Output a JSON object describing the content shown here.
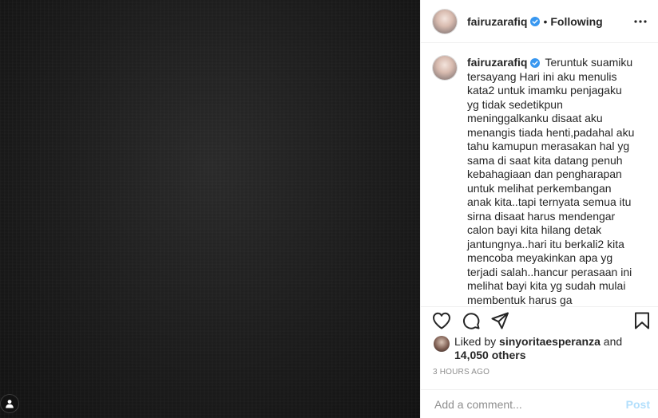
{
  "header": {
    "username": "fairuzarafiq",
    "separator": "•",
    "follow_status": "Following"
  },
  "caption": {
    "username": "fairuzarafiq",
    "text": "Teruntuk suamiku tersayang Hari ini aku menulis kata2 untuk imamku penjagaku yg tidak sedetikpun meninggalkanku disaat aku menangis tiada henti,padahal aku tahu kamupun merasakan hal yg sama di saat kita datang penuh kebahagiaan dan pengharapan untuk melihat perkembangan anak kita..tapi ternyata semua itu sirna disaat harus mendengar calon bayi kita hilang detak jantungnya..hari itu berkali2 kita mencoba meyakinkan apa yg terjadi salah..hancur perasaan ini melihat bayi kita yg sudah mulai membentuk harus ga ada...mommy daddy sayang kamu nak,mommy ibu yg beruntung kamu pernah ada di rahim ini rasa sakit"
  },
  "likes": {
    "prefix": "Liked by",
    "liker": "sinyoritaesperanza",
    "joiner": "and",
    "others": "14,050 others"
  },
  "timestamp": "3 HOURS AGO",
  "comment_box": {
    "placeholder": "Add a comment...",
    "post_label": "Post"
  },
  "colors": {
    "verified_blue": "#3897f0",
    "post_disabled": "#b2dffc",
    "muted_text": "#8e8e8e"
  },
  "icons": [
    "verified-badge-icon",
    "more-options-icon",
    "heart-icon",
    "comment-icon",
    "share-icon",
    "bookmark-icon",
    "user-tag-icon"
  ]
}
